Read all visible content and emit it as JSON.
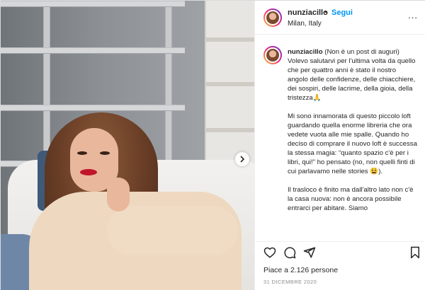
{
  "post": {
    "username": "nunziacillo",
    "separator": "•",
    "follow_label": "Segui",
    "location": "Milan, Italy",
    "more_label": "...",
    "caption": {
      "username": "nunziacillo",
      "para1": "(Non è un post di auguri) Volevo salutarvi per l'ultima volta da quello che per quattro anni è stato il nostro angolo delle confidenze, delle chiacchiere, dei sospiri, delle lacrime, della gioia, della tristezza🙏",
      "para2": "Mi sono innamorata di questo piccolo loft guardando quella enorme libreria che ora vedete vuota alle mie spalle. Quando ho deciso di comprare il nuovo loft è successa la stessa magia: “quanto spazio c'è per i libri, qui!” ho pensato (no, non quelli finti di cui parlavamo nelle stories 😫).",
      "para3": "Il trasloco è finito ma dall'altro lato non c'è la casa nuova: non è ancora possibile entrarci per abitare. Siamo"
    },
    "likes_text": "Piace a 2.126 persone",
    "date_text": "31 DICEMBRE 2020"
  },
  "icons": {
    "like": "heart-icon",
    "comment": "comment-icon",
    "share": "paper-plane-icon",
    "save": "bookmark-icon",
    "next": "chevron-right-icon",
    "more": "more-dots-icon"
  },
  "colors": {
    "link_blue": "#0095f6",
    "text": "#262626",
    "muted": "#8e8e8e",
    "border": "#efefef"
  }
}
